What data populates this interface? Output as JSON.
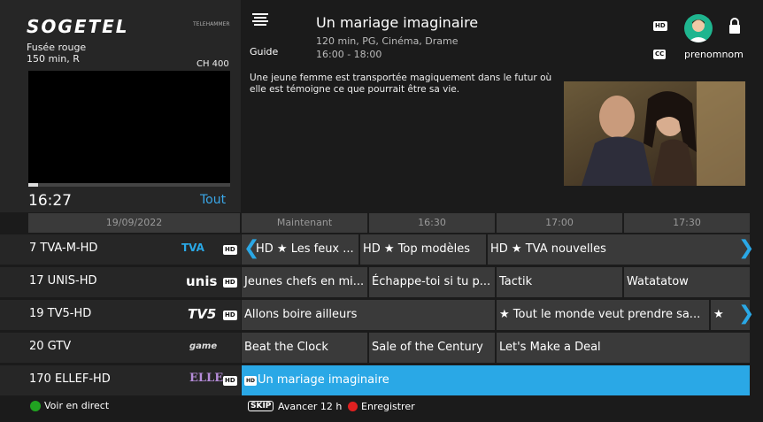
{
  "brand": {
    "logo": "SOGETEL",
    "small_logo": "TELEHAMMER"
  },
  "preview": {
    "title": "Fusée rouge",
    "meta": "150 min, R",
    "channel": "CH 400",
    "clock": "16:27",
    "filter": "Tout",
    "progress_percent": 5
  },
  "program": {
    "guide_label": "Guide",
    "title": "Un mariage imaginaire",
    "meta": "120 min, PG, Cinéma, Drame",
    "time": "16:00 - 18:00",
    "description": "Une jeune femme est transportée magiquement dans le futur où elle est témoigne ce que pourrait être sa vie.",
    "hd_badge": "HD",
    "cc_badge": "CC"
  },
  "user": {
    "name": "prenomnom"
  },
  "timeline": {
    "date": "19/09/2022",
    "slots": [
      "Maintenant",
      "16:30",
      "17:00",
      "17:30"
    ]
  },
  "rows": [
    {
      "channel": "7  TVA-M-HD",
      "logo": "TVA",
      "hd": "HD",
      "programs": [
        "HD ★ Les feux ...",
        "HD ★ Top modèles",
        "HD ★ TVA nouvelles"
      ]
    },
    {
      "channel": "17  UNIS-HD",
      "logo": "unis",
      "hd": "HD",
      "programs": [
        "Jeunes chefs en mi...",
        "Échappe-toi si tu p...",
        "Tactik",
        "Watatatow"
      ]
    },
    {
      "channel": "19  TV5-HD",
      "logo": "TV5",
      "hd": "HD",
      "programs": [
        "Allons boire ailleurs",
        "★ Tout le monde veut prendre sa...",
        "★"
      ]
    },
    {
      "channel": "20  GTV",
      "logo": "game",
      "programs": [
        "Beat the Clock",
        "Sale of the Century",
        "Let's Make a Deal"
      ]
    },
    {
      "channel": "170  ELLEF-HD",
      "logo": "ELLE",
      "hd": "HD",
      "programs": [
        "Un mariage imaginaire"
      ]
    }
  ],
  "footer": {
    "live": "Voir en direct",
    "skip_key": "SKIP",
    "skip_label": "Avancer 12 h",
    "record": "Enregistrer"
  },
  "colors": {
    "accent": "#2aa8e6",
    "green": "#21a321",
    "red": "#e02020"
  }
}
